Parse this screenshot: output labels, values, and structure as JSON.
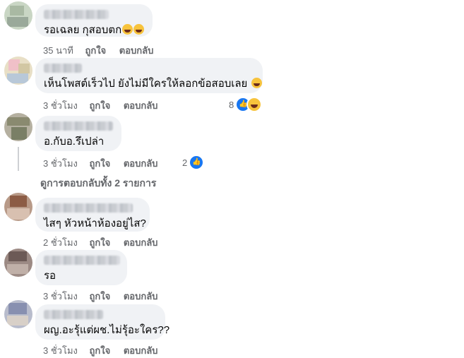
{
  "comments": [
    {
      "text": "รอเฉลย กุสอบตก",
      "time": "35 นาที",
      "like_label": "ถูกใจ",
      "reply_label": "ตอบกลับ"
    },
    {
      "text": "เห็นโพสต์เร็วไป ยังไม่มีใครให้ลอกข้อสอบเลย",
      "time": "3 ชั่วโมง",
      "like_label": "ถูกใจ",
      "reply_label": "ตอบกลับ",
      "reaction_count": "8"
    },
    {
      "text": "อ.กับอ.รึเปล่า",
      "time": "3 ชั่วโมง",
      "like_label": "ถูกใจ",
      "reply_label": "ตอบกลับ",
      "reaction_count": "2",
      "view_replies": "ดูการตอบกลับทั้ง 2 รายการ"
    },
    {
      "text": "ไสๆ หัวหน้าห้องอยู่ไส?",
      "time": "2 ชั่วโมง",
      "like_label": "ถูกใจ",
      "reply_label": "ตอบกลับ"
    },
    {
      "text": "รอ",
      "time": "3 ชั่วโมง",
      "like_label": "ถูกใจ",
      "reply_label": "ตอบกลับ"
    },
    {
      "text": "ผญ.อะรุ้แต่ผช.ไม่รุ้อะใคร??",
      "time": "3 ชั่วโมง",
      "like_label": "ถูกใจ",
      "reply_label": "ตอบกลับ"
    }
  ],
  "colors": {
    "bubble": "#f0f2f5",
    "meta_text": "#65676b",
    "like_blue": "#1877f2"
  },
  "icons": [
    "avatar",
    "haha-emoji",
    "like-reaction-icon",
    "haha-reaction-icon"
  ]
}
